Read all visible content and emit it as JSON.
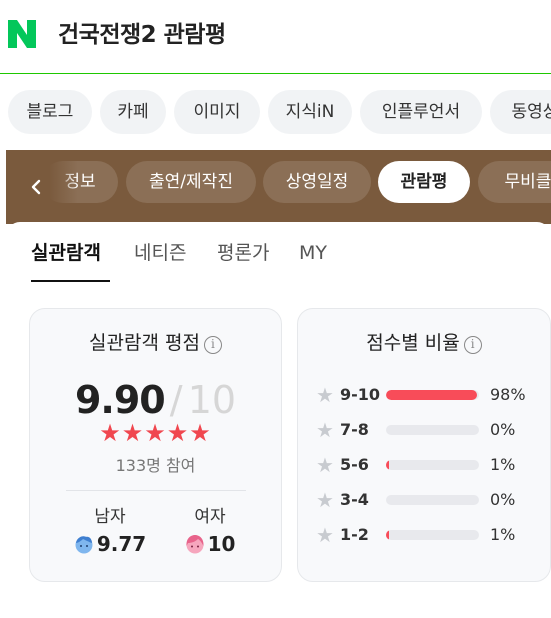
{
  "header": {
    "logo_letter": "N",
    "search_title": "건국전쟁2 관람평"
  },
  "chips": [
    "블로그",
    "카페",
    "이미지",
    "지식iN",
    "인플루언서",
    "동영상"
  ],
  "band_tabs": [
    "정보",
    "출연/제작진",
    "상영일정",
    "관람평",
    "무비클"
  ],
  "band_active": "관람평",
  "subtabs": [
    "실관람객",
    "네티즌",
    "평론가",
    "MY"
  ],
  "rating": {
    "title": "실관람객 평점",
    "score": "9.90",
    "slash": "/",
    "max": "10",
    "stars": "★★★★★",
    "participants": "133명 참여",
    "male_label": "남자",
    "male_score": "9.77",
    "female_label": "여자",
    "female_score": "10"
  },
  "distribution": {
    "title": "점수별 비율",
    "rows": [
      {
        "label": "9-10",
        "percent_text": "98%",
        "percent": 98
      },
      {
        "label": "7-8",
        "percent_text": "0%",
        "percent": 0
      },
      {
        "label": "5-6",
        "percent_text": "1%",
        "percent": 1
      },
      {
        "label": "3-4",
        "percent_text": "0%",
        "percent": 0
      },
      {
        "label": "1-2",
        "percent_text": "1%",
        "percent": 1
      }
    ]
  },
  "colors": {
    "naver_green": "#03c75a",
    "band_brown": "#7a5a3d",
    "star_red": "#f0474f",
    "bar_red": "#f84c59"
  },
  "icons": {
    "info": "info-icon",
    "back": "chevron-left-icon",
    "male": "male-face-icon",
    "female": "female-face-icon",
    "star": "star-icon"
  }
}
